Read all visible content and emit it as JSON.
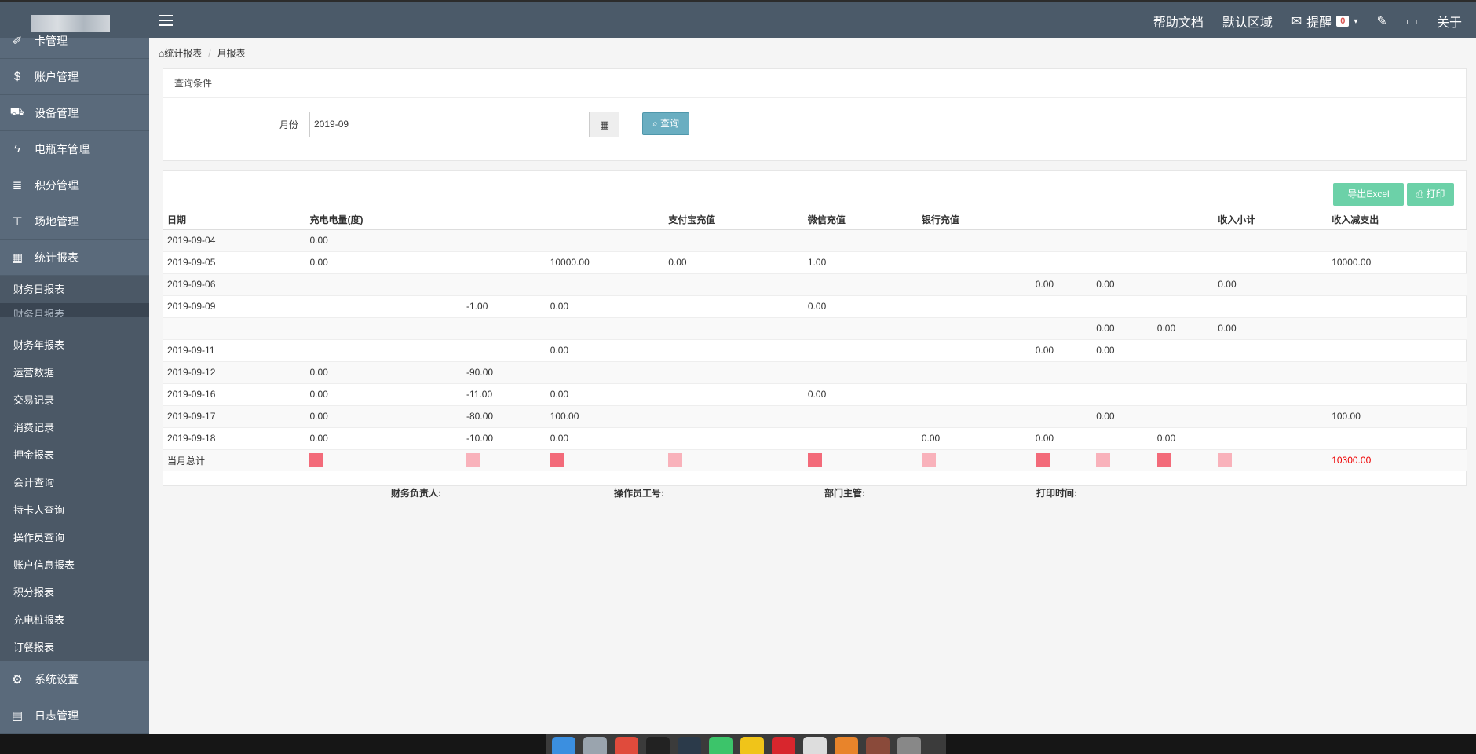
{
  "topbar": {
    "help": "帮助文档",
    "region": "默认区域",
    "alert": "提醒",
    "alert_count": "0",
    "about": "关于"
  },
  "sidebar": {
    "main_top": [
      {
        "label": "卡管理",
        "icon": "tag-icon"
      },
      {
        "label": "账户管理",
        "icon": "dollar-icon"
      },
      {
        "label": "设备管理",
        "icon": "car-icon"
      },
      {
        "label": "电瓶车管理",
        "icon": "bolt-icon"
      },
      {
        "label": "积分管理",
        "icon": "database-icon"
      },
      {
        "label": "场地管理",
        "icon": "sitemap-icon"
      },
      {
        "label": "统计报表",
        "icon": "table-icon"
      }
    ],
    "sub": [
      "财务日报表",
      "财务月报表",
      "财务年报表",
      "运营数据",
      "交易记录",
      "消费记录",
      "押金报表",
      "会计查询",
      "持卡人查询",
      "操作员查询",
      "账户信息报表",
      "积分报表",
      "充电桩报表",
      "订餐报表"
    ],
    "main_bottom": [
      {
        "label": "系统设置",
        "icon": "gear-icon"
      },
      {
        "label": "日志管理",
        "icon": "book-icon"
      }
    ]
  },
  "breadcrumb": {
    "home": "统计报表",
    "current": "月报表"
  },
  "query": {
    "title": "查询条件",
    "month_label": "月份",
    "month_value": "2019-09",
    "button": "查询"
  },
  "actions": {
    "excel": "导出Excel",
    "print": "打印"
  },
  "table": {
    "headers": [
      "日期",
      "充电电量(度)",
      "",
      "",
      "支付宝充值",
      "微信充值",
      "银行充值",
      "",
      "",
      "",
      "收入小计",
      "收入减支出"
    ],
    "rows": [
      [
        "2019-09-04",
        "0.00",
        "",
        "",
        "",
        "",
        "",
        "",
        "",
        "",
        "",
        ""
      ],
      [
        "2019-09-05",
        "0.00",
        "",
        "10000.00",
        "0.00",
        "1.00",
        "",
        "",
        "",
        "",
        "",
        "10000.00"
      ],
      [
        "2019-09-06",
        "",
        "",
        "",
        "",
        "",
        "",
        "0.00",
        "0.00",
        "",
        "0.00",
        ""
      ],
      [
        "2019-09-09",
        "",
        "-1.00",
        "0.00",
        "",
        "0.00",
        "",
        "",
        "",
        "",
        "",
        ""
      ],
      [
        "",
        "",
        "",
        "",
        "",
        "",
        "",
        "",
        "0.00",
        "0.00",
        "0.00",
        ""
      ],
      [
        "2019-09-11",
        "",
        "",
        "0.00",
        "",
        "",
        "",
        "0.00",
        "0.00",
        "",
        "",
        ""
      ],
      [
        "2019-09-12",
        "0.00",
        "-90.00",
        "",
        "",
        "",
        "",
        "",
        "",
        "",
        "",
        ""
      ],
      [
        "2019-09-16",
        "0.00",
        "-11.00",
        "0.00",
        "",
        "0.00",
        "",
        "",
        "",
        "",
        "",
        ""
      ],
      [
        "2019-09-17",
        "0.00",
        "-80.00",
        "100.00",
        "",
        "",
        "",
        "",
        "0.00",
        "",
        "",
        "100.00"
      ],
      [
        "2019-09-18",
        "0.00",
        "-10.00",
        "0.00",
        "",
        "",
        "0.00",
        "0.00",
        "",
        "0.00",
        "",
        ""
      ]
    ],
    "total_label": "当月总计",
    "total_value": "10300.00"
  },
  "signatures": {
    "finance": "财务负责人:",
    "operator": "操作员工号:",
    "supervisor": "部门主管:",
    "print_time": "打印时间:"
  }
}
